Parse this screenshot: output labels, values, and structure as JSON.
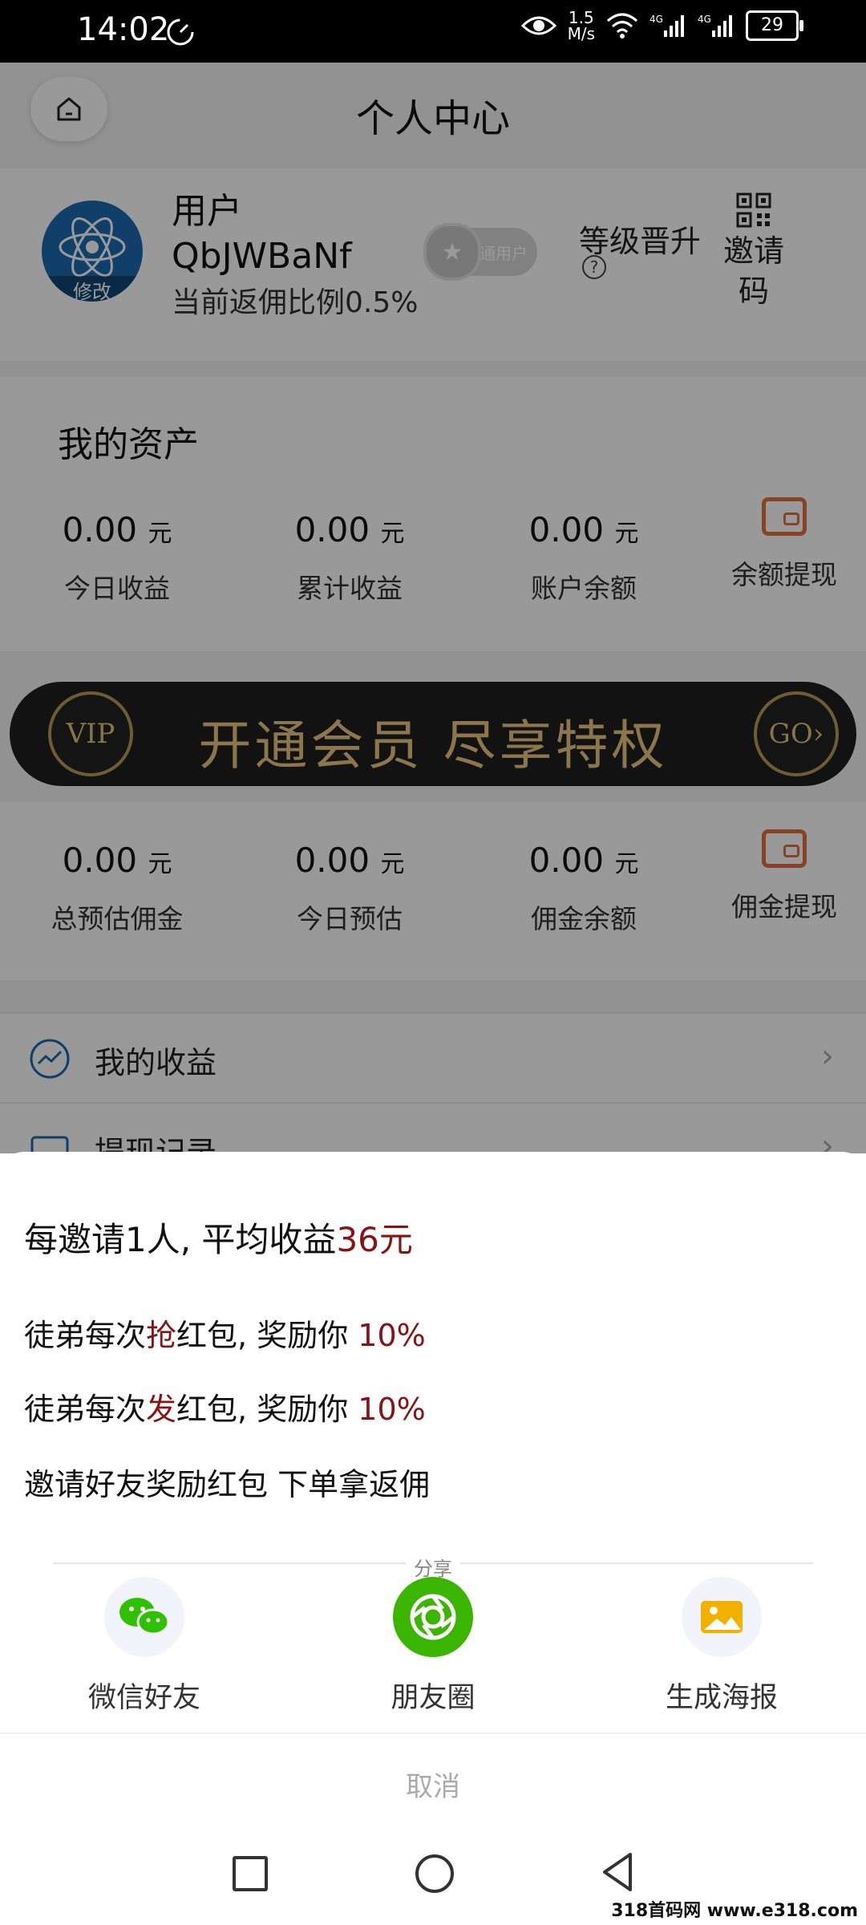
{
  "status_bar": {
    "time": "14:02",
    "net_speed_value": "1.5",
    "net_speed_unit": "M/s",
    "battery": "29",
    "signal1_label": "4G",
    "signal2_label": "4G"
  },
  "page": {
    "title": "个人中心",
    "profile": {
      "username": "用户QbJWBaNf",
      "ratio": "当前返佣比例0.5%",
      "badge": "普通用户",
      "level_up": "等级晋升",
      "level_help": "?",
      "invite_code": "邀请码",
      "avatar_text": "修改"
    },
    "assets": {
      "title": "我的资产",
      "unit": "元",
      "items": [
        {
          "value": "0.00",
          "label": "今日收益"
        },
        {
          "value": "0.00",
          "label": "累计收益"
        },
        {
          "value": "0.00",
          "label": "账户余额"
        }
      ],
      "withdraw": "余额提现"
    },
    "vip_banner": {
      "left": "VIP",
      "text": "开通会员 尽享特权",
      "right": "GO›"
    },
    "commission": {
      "items": [
        {
          "value": "0.00",
          "label": "总预估佣金"
        },
        {
          "value": "0.00",
          "label": "今日预估"
        },
        {
          "value": "0.00",
          "label": "佣金余额"
        }
      ],
      "withdraw": "佣金提现"
    },
    "menu": [
      {
        "label": "我的收益"
      },
      {
        "label": "提现记录"
      }
    ]
  },
  "sheet": {
    "headline_prefix": "每邀请1人, 平均收益",
    "headline_amount": "36元",
    "rule1_a": "徒弟每次",
    "rule1_b": "抢",
    "rule1_c": "红包, 奖励你 ",
    "rule1_pct": "10%",
    "rule2_a": "徒弟每次",
    "rule2_b": "发",
    "rule2_c": "红包, 奖励你 ",
    "rule2_pct": "10%",
    "line4": "邀请好友奖励红包 下单拿返佣",
    "share_label": "分享",
    "share_options": [
      {
        "label": "微信好友",
        "icon": "wechat-icon"
      },
      {
        "label": "朋友圈",
        "icon": "moments-icon"
      },
      {
        "label": "生成海报",
        "icon": "poster-icon"
      }
    ],
    "cancel": "取消"
  },
  "watermark": "318首码网 www.e318.com",
  "colors": {
    "accent_red": "#8b1212",
    "wallet_orange": "#e07040",
    "wechat_green": "#2dc100",
    "moments_green": "#3ab500",
    "poster_yellow": "#f2b100"
  }
}
